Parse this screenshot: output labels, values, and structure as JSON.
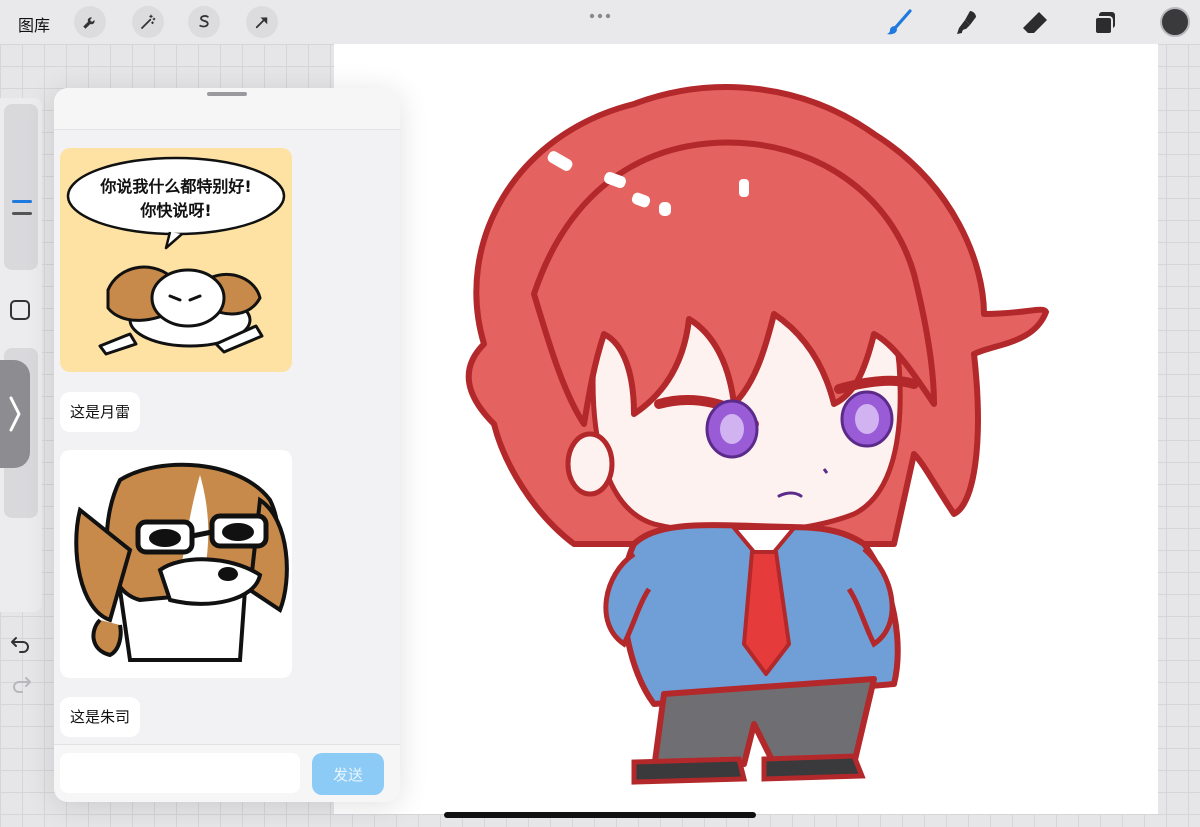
{
  "toolbar": {
    "gallery_label": "图库",
    "left_tools": [
      {
        "name": "actions",
        "icon": "wrench-icon"
      },
      {
        "name": "adjustments",
        "icon": "magic-wand-icon"
      },
      {
        "name": "selection",
        "icon": "selection-s-icon"
      },
      {
        "name": "transform",
        "icon": "arrow-cursor-icon"
      }
    ],
    "more_icon": "ellipsis-icon",
    "right_tools": [
      {
        "name": "brush",
        "icon": "brush-icon",
        "active": true
      },
      {
        "name": "smudge",
        "icon": "smudge-icon"
      },
      {
        "name": "eraser",
        "icon": "eraser-icon"
      },
      {
        "name": "layers",
        "icon": "layers-icon"
      }
    ],
    "current_color": "#3a3a3c",
    "accent_color": "#1f7ae0"
  },
  "sidebar": {
    "modify_icon": "square-icon",
    "toggle_icon": "chevron-right-icon",
    "undo_icon": "undo-icon",
    "redo_icon": "redo-icon"
  },
  "chat": {
    "messages": [
      {
        "type": "image",
        "sticker": "dog-sticker-1",
        "caption_lines": [
          "你说我什么都特别好!",
          "你快说呀!"
        ]
      },
      {
        "type": "text",
        "text": "这是月雷"
      },
      {
        "type": "image",
        "sticker": "dog-sticker-2"
      },
      {
        "type": "text",
        "text": "这是朱司"
      }
    ],
    "input": {
      "value": "",
      "placeholder": ""
    },
    "send_label": "发送"
  },
  "canvas": {
    "artwork": "chibi-red-hair-character",
    "colors": {
      "hair": "#e4625f",
      "outline": "#b3282a",
      "jacket": "#6f9fd6",
      "tie": "#e63b3b",
      "pants": "#6f6f73",
      "eyes": "#9a5bd6",
      "skin": "#fdf2ef"
    }
  }
}
